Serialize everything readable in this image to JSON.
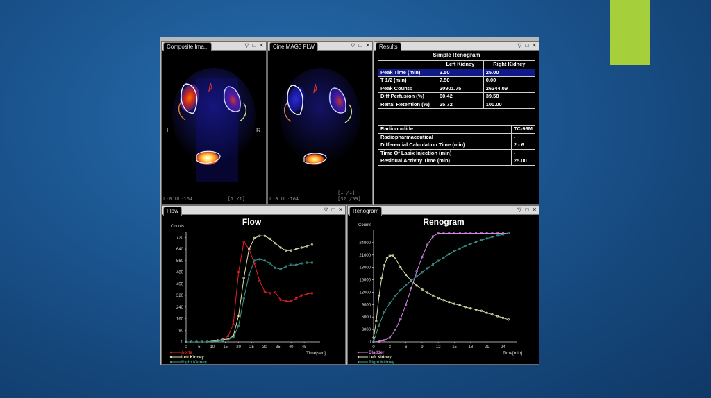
{
  "panels": {
    "composite": {
      "tab": "Composite Ima...",
      "left_label": "L",
      "right_label": "R",
      "bottom_left": "L:0 UL:164",
      "bottom_right": "[1 /1]"
    },
    "cine": {
      "tab": "Cine MAG3 FLW",
      "bottom_left": "L:0 UL:164",
      "frame_top": "[1 /1]",
      "frame_bottom": "[32 /59]"
    },
    "results": {
      "tab": "Results",
      "title": "Simple Renogram",
      "headers": [
        "",
        "Left Kidney",
        "Right Kidney"
      ],
      "rows": [
        [
          "Peak Time (min)",
          "3.50",
          "25.00"
        ],
        [
          "T 1/2  (min)",
          "7.50",
          "0.00"
        ],
        [
          "Peak Counts",
          "20901.75",
          "26244.09"
        ],
        [
          "Diff Perfusion (%)",
          "60.42",
          "39.58"
        ],
        [
          "Renal Retention (%)",
          "25.72",
          "100.00"
        ]
      ],
      "info_rows": [
        [
          "Radionuclide",
          "TC-99M"
        ],
        [
          "Radiopharmaceutical",
          "-"
        ],
        [
          "Differential Calculation Time (min)",
          "2 - 6"
        ],
        [
          "Time Of Lasix Injection (min)",
          "-"
        ],
        [
          "Residual Activity Time  (min)",
          "25.00"
        ]
      ]
    },
    "flow": {
      "tab": "Flow"
    },
    "renogram": {
      "tab": "Renogram"
    }
  },
  "window_controls": {
    "dropdown": "▽",
    "maximize": "□",
    "close": "✕"
  },
  "colors": {
    "accent": "#a6cf3c",
    "aorta": "#e8202a",
    "left_kidney": "#e3e3b0",
    "right_kidney": "#3f9a8e",
    "bladder": "#d985e8",
    "selected_row": "#0f1a88"
  },
  "chart_data": [
    {
      "type": "line",
      "title": "Flow",
      "ylabel": "Counts",
      "xlabel": "Time[sec]",
      "xlim": [
        0,
        50
      ],
      "ylim": [
        0,
        760
      ],
      "xticks": [
        0,
        5,
        10,
        15,
        20,
        25,
        30,
        35,
        40,
        45
      ],
      "yticks": [
        0,
        80,
        160,
        240,
        320,
        400,
        480,
        560,
        640,
        720
      ],
      "legend_position": "bottom-left",
      "series": [
        {
          "name": "Aorta",
          "x": [
            0,
            2,
            4,
            6,
            8,
            10,
            12,
            14,
            16,
            18,
            20,
            22,
            24,
            26,
            28,
            30,
            32,
            34,
            36,
            38,
            40,
            42,
            44,
            46,
            48
          ],
          "values": [
            0,
            0,
            0,
            0,
            0,
            5,
            10,
            15,
            40,
            120,
            480,
            690,
            640,
            540,
            420,
            345,
            335,
            340,
            290,
            280,
            280,
            300,
            320,
            330,
            335
          ]
        },
        {
          "name": "Left Kidney",
          "x": [
            0,
            2,
            4,
            6,
            8,
            10,
            12,
            14,
            16,
            18,
            20,
            22,
            24,
            26,
            28,
            30,
            32,
            34,
            36,
            38,
            40,
            42,
            44,
            46,
            48
          ],
          "values": [
            0,
            0,
            0,
            0,
            0,
            5,
            10,
            15,
            20,
            40,
            180,
            440,
            640,
            715,
            730,
            730,
            710,
            680,
            650,
            630,
            630,
            640,
            650,
            660,
            670
          ]
        },
        {
          "name": "Right Kidney",
          "x": [
            0,
            2,
            4,
            6,
            8,
            10,
            12,
            14,
            16,
            18,
            20,
            22,
            24,
            26,
            28,
            30,
            32,
            34,
            36,
            38,
            40,
            42,
            44,
            46,
            48
          ],
          "values": [
            0,
            0,
            0,
            0,
            0,
            3,
            6,
            10,
            15,
            30,
            110,
            300,
            460,
            560,
            570,
            560,
            540,
            510,
            500,
            520,
            530,
            530,
            540,
            545,
            545
          ]
        }
      ]
    },
    {
      "type": "line",
      "title": "Renogram",
      "ylabel": "Counts",
      "xlabel": "Time[min]",
      "xlim": [
        0,
        26
      ],
      "ylim": [
        0,
        27000
      ],
      "xticks": [
        0,
        3,
        6,
        9,
        12,
        15,
        18,
        21,
        24
      ],
      "yticks": [
        0,
        3000,
        6000,
        9000,
        12000,
        15000,
        18000,
        21000,
        24000
      ],
      "legend_position": "bottom-left",
      "series": [
        {
          "name": "Bladder",
          "x": [
            0,
            1,
            2,
            3,
            4,
            5,
            6,
            7,
            8,
            9,
            10,
            11,
            12,
            13,
            14,
            15,
            16,
            17,
            18,
            19,
            20,
            21,
            22,
            23,
            24,
            25
          ],
          "values": [
            0,
            100,
            400,
            1000,
            2800,
            5500,
            9000,
            13000,
            17000,
            20500,
            23500,
            25500,
            26244,
            26244,
            26244,
            26244,
            26244,
            26244,
            26244,
            26244,
            26244,
            26244,
            26244,
            26244,
            26244,
            26244
          ]
        },
        {
          "name": "Left Kidney",
          "x": [
            0,
            0.5,
            1,
            1.5,
            2,
            2.5,
            3,
            3.5,
            4,
            5,
            6,
            7,
            8,
            9,
            10,
            11,
            12,
            13,
            14,
            15,
            16,
            17,
            18,
            19,
            20,
            21,
            22,
            23,
            24,
            25
          ],
          "values": [
            1000,
            5000,
            11000,
            15500,
            18500,
            20200,
            20800,
            20900,
            20300,
            18000,
            16200,
            14800,
            13600,
            12700,
            11900,
            11200,
            10600,
            10100,
            9600,
            9200,
            8800,
            8400,
            8100,
            7800,
            7500,
            7000,
            6600,
            6200,
            5800,
            5400
          ]
        },
        {
          "name": "Right Kidney",
          "x": [
            0,
            1,
            2,
            3,
            4,
            5,
            6,
            7,
            8,
            9,
            10,
            11,
            12,
            13,
            14,
            15,
            16,
            17,
            18,
            19,
            20,
            21,
            22,
            23,
            24,
            25
          ],
          "values": [
            0,
            4000,
            7200,
            9300,
            11000,
            12500,
            13700,
            14800,
            15800,
            16800,
            17800,
            18700,
            19600,
            20400,
            21200,
            21900,
            22600,
            23200,
            23700,
            24200,
            24600,
            25000,
            25400,
            25700,
            26000,
            26244
          ]
        }
      ]
    }
  ]
}
